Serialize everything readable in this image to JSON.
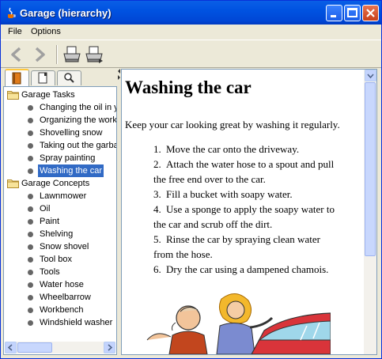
{
  "window": {
    "title": "Garage (hierarchy)"
  },
  "menu": {
    "items": [
      "File",
      "Options"
    ]
  },
  "toolbar": {
    "buttons": [
      "back-arrow-icon",
      "forward-arrow-icon",
      "print-icon",
      "print-setup-icon"
    ]
  },
  "navigator": {
    "tabs": [
      "contents-icon",
      "index-icon",
      "search-icon"
    ],
    "tree": [
      {
        "label": "Garage Tasks",
        "type": "folder"
      },
      {
        "label": "Changing the oil in y",
        "type": "leaf"
      },
      {
        "label": "Organizing the work",
        "type": "leaf"
      },
      {
        "label": "Shovelling snow",
        "type": "leaf"
      },
      {
        "label": "Taking out the garba",
        "type": "leaf"
      },
      {
        "label": "Spray painting",
        "type": "leaf"
      },
      {
        "label": "Washing the car",
        "type": "leaf",
        "selected": true
      },
      {
        "label": "Garage Concepts",
        "type": "folder"
      },
      {
        "label": "Lawnmower",
        "type": "leaf"
      },
      {
        "label": "Oil",
        "type": "leaf"
      },
      {
        "label": "Paint",
        "type": "leaf"
      },
      {
        "label": "Shelving",
        "type": "leaf"
      },
      {
        "label": "Snow shovel",
        "type": "leaf"
      },
      {
        "label": "Tool box",
        "type": "leaf"
      },
      {
        "label": "Tools",
        "type": "leaf"
      },
      {
        "label": "Water hose",
        "type": "leaf"
      },
      {
        "label": "Wheelbarrow",
        "type": "leaf"
      },
      {
        "label": "Workbench",
        "type": "leaf"
      },
      {
        "label": "Windshield washer",
        "type": "leaf"
      }
    ]
  },
  "content": {
    "heading": "Washing the car",
    "intro": "Keep your car looking great by washing it regularly.",
    "steps": [
      {
        "num": "1.",
        "lines": [
          "Move the car onto the driveway."
        ]
      },
      {
        "num": "2.",
        "lines": [
          "Attach the water hose to a spout and pull",
          "the free end over to the car."
        ]
      },
      {
        "num": "3.",
        "lines": [
          "Fill a bucket with soapy water."
        ]
      },
      {
        "num": "4.",
        "lines": [
          "Use a sponge to apply the soapy water to",
          "the car and scrub off the dirt."
        ]
      },
      {
        "num": "5.",
        "lines": [
          "Rinse the car by spraying clean water",
          "from the hose."
        ]
      },
      {
        "num": "6.",
        "lines": [
          "Dry the car using a dampened chamois."
        ]
      }
    ]
  },
  "colors": {
    "titlebar": "#0054e3",
    "selection": "#316ac5",
    "chrome": "#ece9d8"
  }
}
